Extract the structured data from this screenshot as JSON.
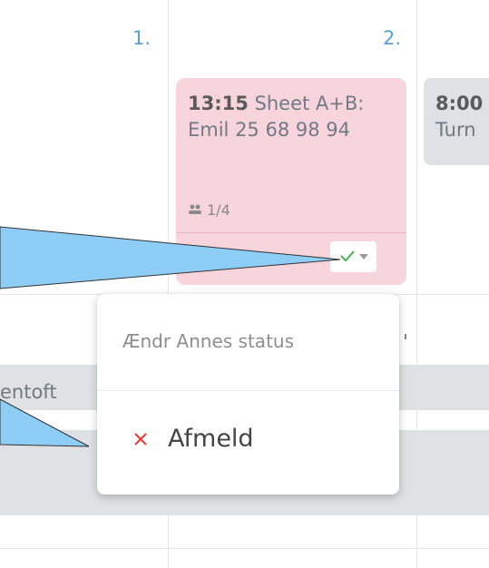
{
  "calendar": {
    "day_numbers": [
      "1.",
      "2."
    ],
    "events": [
      {
        "time": "13:15",
        "title": "Sheet A+B: Emil 25 68 98 94",
        "participants": "1/4",
        "color": "#f8d5dc"
      },
      {
        "time": "8:00",
        "title": "Turn",
        "color": "#dfe1e4"
      }
    ],
    "row_text": "entoft"
  },
  "status_button": {
    "icon": "check-icon",
    "check_color": "#4caf50"
  },
  "dropdown": {
    "header": "Ændr Annes status",
    "items": [
      {
        "label": "Afmeld",
        "icon": "close-icon",
        "icon_color": "#e53935"
      }
    ]
  },
  "callouts": {
    "color": "#8ecdf5"
  }
}
